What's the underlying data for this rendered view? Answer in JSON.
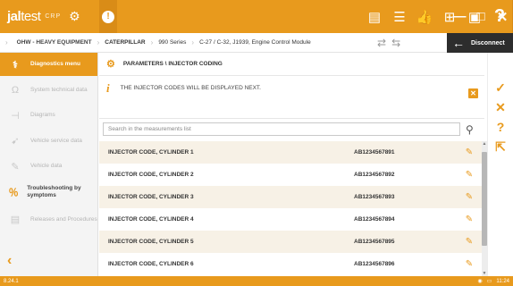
{
  "app": {
    "logo_main": "jal",
    "logo_light": "test",
    "logo_sub": "CRP",
    "version": "8.24.1",
    "clock": "11:24"
  },
  "breadcrumb": {
    "items": [
      "OHW - HEAVY EQUIPMENT",
      "CATERPILLAR",
      "990 Series",
      "C-27 / C-32, J1939, Engine Control Module"
    ],
    "disconnect_label": "Disconnect"
  },
  "sidebar": {
    "items": [
      {
        "label": "Diagnostics menu",
        "icon": "diagnostics-icon"
      },
      {
        "label": "System technical data",
        "icon": "omega-icon"
      },
      {
        "label": "Diagrams",
        "icon": "diagram-icon"
      },
      {
        "label": "Vehicle service data",
        "icon": "service-icon"
      },
      {
        "label": "Vehicle data",
        "icon": "wrench-icon"
      },
      {
        "label": "Troubleshooting by symptoms",
        "icon": "troubleshoot-icon"
      },
      {
        "label": "Releases and Procedures",
        "icon": "procedures-icon"
      }
    ]
  },
  "main": {
    "title": "PARAMETERS \\ INJECTOR CODING",
    "info_text": "THE INJECTOR CODES WILL BE DISPLAYED NEXT.",
    "search_placeholder": "Search in the measurements list",
    "rows": [
      {
        "name": "INJECTOR CODE, CYLINDER 1",
        "code": "AB1234567891"
      },
      {
        "name": "INJECTOR CODE, CYLINDER 2",
        "code": "AB1234567892"
      },
      {
        "name": "INJECTOR CODE, CYLINDER 3",
        "code": "AB1234567893"
      },
      {
        "name": "INJECTOR CODE, CYLINDER 4",
        "code": "AB1234567894"
      },
      {
        "name": "INJECTOR CODE, CYLINDER 5",
        "code": "AB1234567895"
      },
      {
        "name": "INJECTOR CODE, CYLINDER 6",
        "code": "AB1234567896"
      }
    ]
  },
  "colors": {
    "accent": "#e89a1d",
    "dark": "#2d2d2d",
    "row_stripe": "#f7f1e6"
  }
}
